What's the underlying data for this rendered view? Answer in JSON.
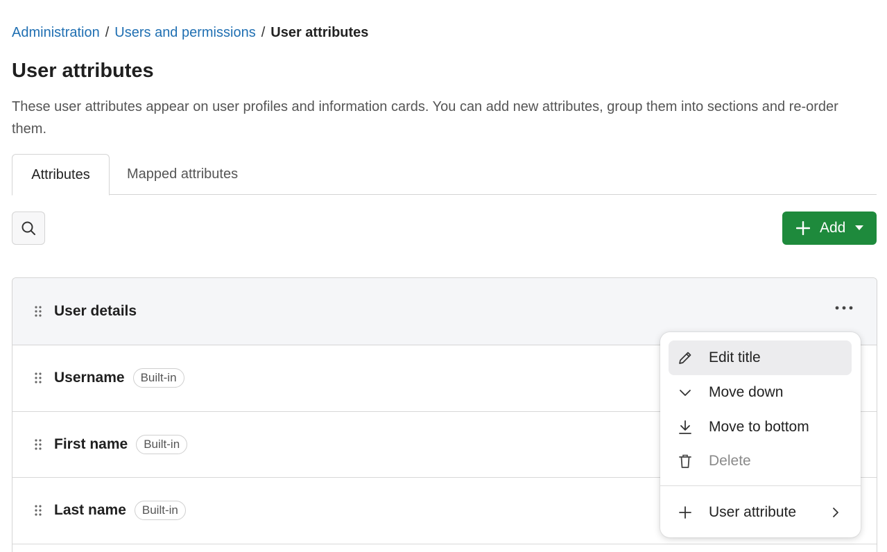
{
  "breadcrumb": {
    "items": [
      "Administration",
      "Users and permissions"
    ],
    "current": "User attributes",
    "separator": "/"
  },
  "page": {
    "title": "User attributes",
    "description": "These user attributes appear on user profiles and information cards. You can add new attributes, group them into sections and re-order them."
  },
  "tabs": [
    {
      "label": "Attributes",
      "active": true
    },
    {
      "label": "Mapped attributes",
      "active": false
    }
  ],
  "toolbar": {
    "search_icon": "search-icon",
    "add_label": "Add",
    "add_color": "#1e8a3c"
  },
  "section": {
    "title": "User details",
    "rows": [
      {
        "label": "Username",
        "badge": "Built-in"
      },
      {
        "label": "First name",
        "badge": "Built-in"
      },
      {
        "label": "Last name",
        "badge": "Built-in"
      }
    ]
  },
  "menu": {
    "items": [
      {
        "label": "Edit title",
        "icon": "pencil-icon",
        "state": "hovered"
      },
      {
        "label": "Move down",
        "icon": "chevron-down-icon"
      },
      {
        "label": "Move to bottom",
        "icon": "arrow-to-bottom-icon"
      },
      {
        "label": "Delete",
        "icon": "trash-icon",
        "state": "disabled"
      },
      {
        "label": "User attribute",
        "icon": "plus-icon",
        "submenu": true
      }
    ]
  }
}
